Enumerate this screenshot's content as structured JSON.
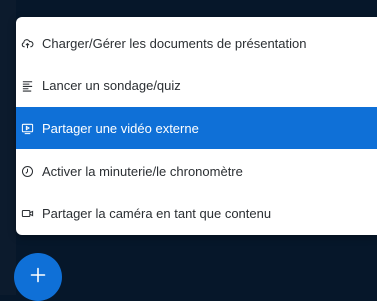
{
  "menu": {
    "items": [
      {
        "label": "Charger/Gérer les documents de présentation",
        "icon": "cloud-upload-icon"
      },
      {
        "label": "Lancer un sondage/quiz",
        "icon": "poll-list-icon"
      },
      {
        "label": "Partager une vidéo externe",
        "icon": "external-video-icon",
        "selected": true
      },
      {
        "label": "Activer la minuterie/le chronomètre",
        "icon": "timer-icon"
      },
      {
        "label": "Partager la caméra en tant que contenu",
        "icon": "camera-icon"
      }
    ]
  },
  "fab": {
    "label": "+",
    "icon": "plus-icon"
  },
  "colors": {
    "background": "#06172a",
    "accent": "#0f70d7",
    "menu_text": "#2b2f33",
    "menu_background": "#ffffff"
  }
}
